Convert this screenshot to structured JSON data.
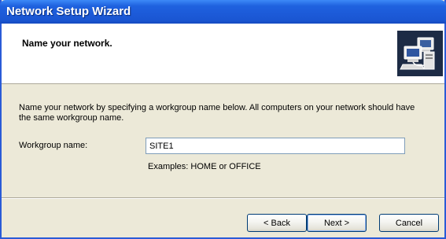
{
  "window": {
    "title": "Network Setup Wizard"
  },
  "header": {
    "title": "Name your network.",
    "icon": "network-computers-icon"
  },
  "content": {
    "description": "Name your network by specifying a workgroup name below. All computers on your network should have the same workgroup name.",
    "workgroup_label": "Workgroup name:",
    "workgroup_value": "SITE1",
    "examples": "Examples: HOME or OFFICE"
  },
  "buttons": {
    "back": "< Back",
    "next": "Next >",
    "cancel": "Cancel"
  },
  "colors": {
    "title_bar": "#1f62df",
    "dialog_bg": "#ece9d8",
    "header_bg": "#ffffff",
    "button_border": "#003c74"
  }
}
